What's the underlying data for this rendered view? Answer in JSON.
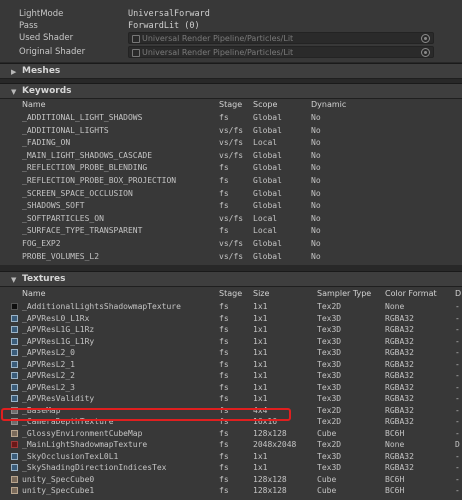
{
  "info": {
    "lightmode_label": "LightMode",
    "lightmode_value": "UniversalForward",
    "pass_label": "Pass",
    "pass_value": "ForwardLit (0)",
    "used_shader_label": "Used Shader",
    "used_shader_value": "Universal Render Pipeline/Particles/Lit",
    "original_shader_label": "Original Shader",
    "original_shader_value": "Universal Render Pipeline/Particles/Lit"
  },
  "sections": {
    "meshes": "Meshes",
    "keywords": "Keywords",
    "textures": "Textures"
  },
  "keywords": {
    "columns": [
      "Name",
      "Stage",
      "Scope",
      "Dynamic"
    ],
    "rows": [
      [
        "_ADDITIONAL_LIGHT_SHADOWS",
        "fs",
        "Global",
        "No"
      ],
      [
        "_ADDITIONAL_LIGHTS",
        "vs/fs",
        "Global",
        "No"
      ],
      [
        "_FADING_ON",
        "vs/fs",
        "Local",
        "No"
      ],
      [
        "_MAIN_LIGHT_SHADOWS_CASCADE",
        "vs/fs",
        "Global",
        "No"
      ],
      [
        "_REFLECTION_PROBE_BLENDING",
        "fs",
        "Global",
        "No"
      ],
      [
        "_REFLECTION_PROBE_BOX_PROJECTION",
        "fs",
        "Global",
        "No"
      ],
      [
        "_SCREEN_SPACE_OCCLUSION",
        "fs",
        "Global",
        "No"
      ],
      [
        "_SHADOWS_SOFT",
        "fs",
        "Global",
        "No"
      ],
      [
        "_SOFTPARTICLES_ON",
        "vs/fs",
        "Local",
        "No"
      ],
      [
        "_SURFACE_TYPE_TRANSPARENT",
        "fs",
        "Local",
        "No"
      ],
      [
        "FOG_EXP2",
        "vs/fs",
        "Global",
        "No"
      ],
      [
        "PROBE_VOLUMES_L2",
        "vs/fs",
        "Global",
        "No"
      ]
    ]
  },
  "textures": {
    "columns": [
      "Name",
      "Stage",
      "Size",
      "Sampler Type",
      "Color Format",
      "D"
    ],
    "rows": [
      {
        "icon": "black",
        "cells": [
          "_AdditionalLightsShadowmapTexture",
          "fs",
          "1x1",
          "Tex2D",
          "None",
          "-"
        ]
      },
      {
        "icon": "3d",
        "cells": [
          "_APVResL0_L1Rx",
          "fs",
          "1x1",
          "Tex3D",
          "RGBA32",
          "-"
        ]
      },
      {
        "icon": "3d",
        "cells": [
          "_APVResL1G_L1Rz",
          "fs",
          "1x1",
          "Tex3D",
          "RGBA32",
          "-"
        ]
      },
      {
        "icon": "3d",
        "cells": [
          "_APVResL1G_L1Ry",
          "fs",
          "1x1",
          "Tex3D",
          "RGBA32",
          "-"
        ]
      },
      {
        "icon": "3d",
        "cells": [
          "_APVResL2_0",
          "fs",
          "1x1",
          "Tex3D",
          "RGBA32",
          "-"
        ]
      },
      {
        "icon": "3d",
        "cells": [
          "_APVResL2_1",
          "fs",
          "1x1",
          "Tex3D",
          "RGBA32",
          "-"
        ]
      },
      {
        "icon": "3d",
        "cells": [
          "_APVResL2_2",
          "fs",
          "1x1",
          "Tex3D",
          "RGBA32",
          "-"
        ]
      },
      {
        "icon": "3d",
        "cells": [
          "_APVResL2_3",
          "fs",
          "1x1",
          "Tex3D",
          "RGBA32",
          "-"
        ]
      },
      {
        "icon": "3d",
        "cells": [
          "_APVResValidity",
          "fs",
          "1x1",
          "Tex3D",
          "RGBA32",
          "-"
        ]
      },
      {
        "icon": "gray",
        "cells": [
          "_BaseMap",
          "fs",
          "4x4",
          "Tex2D",
          "RGBA32",
          "-"
        ]
      },
      {
        "icon": "gray",
        "cells": [
          "_CameraDepthTexture",
          "fs",
          "16x16",
          "Tex2D",
          "RGBA32",
          "-"
        ]
      },
      {
        "icon": "cube",
        "cells": [
          "_GlossyEnvironmentCubeMap",
          "fs",
          "128x128",
          "Cube",
          "BC6H",
          "-"
        ]
      },
      {
        "icon": "red",
        "cells": [
          "_MainLightShadowmapTexture",
          "fs",
          "2048x2048",
          "Tex2D",
          "None",
          "D"
        ]
      },
      {
        "icon": "3d",
        "cells": [
          "_SkyOcclusionTexL0L1",
          "fs",
          "1x1",
          "Tex3D",
          "RGBA32",
          "-"
        ]
      },
      {
        "icon": "3d",
        "cells": [
          "_SkyShadingDirectionIndicesTex",
          "fs",
          "1x1",
          "Tex3D",
          "RGBA32",
          "-"
        ]
      },
      {
        "icon": "cube",
        "cells": [
          "unity_SpecCube0",
          "fs",
          "128x128",
          "Cube",
          "BC6H",
          "-"
        ]
      },
      {
        "icon": "cube",
        "cells": [
          "unity_SpecCube1",
          "fs",
          "128x128",
          "Cube",
          "BC6H",
          "-"
        ]
      }
    ]
  },
  "icons": {
    "object_field": "shader-object-icon",
    "target": "object-picker-icon",
    "fold": "foldout-triangle-icon"
  },
  "colors": {
    "highlight": "#e01f1f",
    "panel_bg": "#383838",
    "header_bg": "#3e3e3e"
  }
}
